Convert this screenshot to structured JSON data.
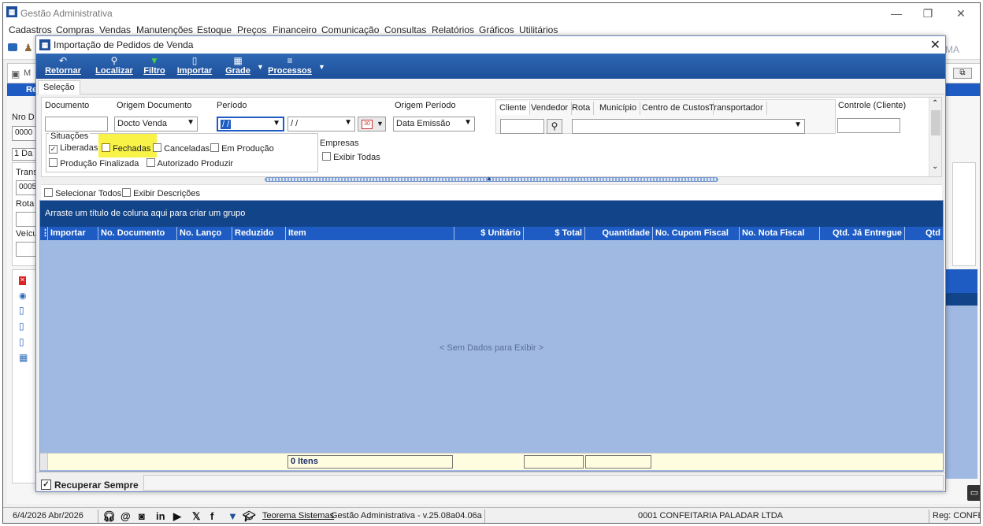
{
  "main_window": {
    "title": "Gestão Administrativa",
    "menu": [
      "Cadastros",
      "Compras",
      "Vendas",
      "Manutenções",
      "Estoque",
      "Preços",
      "Financeiro",
      "Comunicação",
      "Consultas",
      "Relatórios",
      "Gráficos",
      "Utilitários"
    ],
    "controls": {
      "minimize": "—",
      "maximize": "❐",
      "close": "✕"
    },
    "bg_fragments": {
      "nro": "Nro D",
      "nro_val": "0000",
      "tab": "1 Da",
      "trans": "Trans",
      "trans_val": "0005",
      "rota": "Rota",
      "veic": "Veícu",
      "ma": "MA",
      "re": "Re",
      "m": "M"
    }
  },
  "dialog": {
    "title": "Importação de Pedidos de Venda",
    "close": "✕",
    "toolbar": {
      "retornar": "Retornar",
      "localizar": "Localizar",
      "filtro": "Filtro",
      "importar": "Importar",
      "grade": "Grade",
      "processos": "Processos"
    },
    "tab": "Seleção",
    "filters": {
      "documento_label": "Documento",
      "documento_value": "",
      "origem_documento_label": "Origem Documento",
      "origem_documento_value": "Docto Venda",
      "periodo_label": "Período",
      "periodo_inicio": " / /",
      "periodo_fim": " / /",
      "origem_periodo_label": "Origem Período",
      "origem_periodo_value": "Data Emissão",
      "controle_label": "Controle (Cliente)",
      "controle_value": "",
      "situacoes_label": "Situações",
      "situacoes": [
        {
          "label": "Liberadas",
          "checked": true
        },
        {
          "label": "Fechadas",
          "checked": false
        },
        {
          "label": "Canceladas",
          "checked": false
        },
        {
          "label": "Em Produção",
          "checked": false
        },
        {
          "label": "Produção Finalizada",
          "checked": false
        },
        {
          "label": "Autorizado Produzir",
          "checked": false
        }
      ],
      "empresas_label": "Empresas",
      "exibir_todas": "Exibir Todas",
      "cliente_tabs": [
        "Cliente",
        "Vendedor",
        "Rota",
        "Município",
        "Centro de Custos",
        "Transportador"
      ]
    },
    "selecionar_todos": "Selecionar Todos",
    "exibir_descricoes": "Exibir Descrições",
    "grid": {
      "group_hint": "Arraste um título de coluna aqui para criar um grupo",
      "columns": [
        "Importar",
        "No. Documento",
        "No. Lanço",
        "Reduzido",
        "Item",
        "$ Unitário",
        "$ Total",
        "Quantidade",
        "No. Cupom Fiscal",
        "No. Nota Fiscal",
        "Qtd. Já Entregue",
        "Qtd"
      ],
      "empty_message": "< Sem Dados para Exibir >",
      "footer_count": "0 Itens"
    },
    "recuperar_sempre": "Recuperar Sempre"
  },
  "statusbar": {
    "date": "6/4/2026 Abr/2026",
    "teorema": "Teorema Sistemas",
    "version": "Gestão Administrativa - v.25.08a04.06a",
    "company": "0001 CONFEITARIA PALADAR LTDA",
    "reg": "Reg: CONFE"
  },
  "colors": {
    "toolbar": "#1d4f9a",
    "grid_header": "#1e5cc4",
    "group_panel": "#124489",
    "grid_body": "#a0b9e2",
    "highlight": "#f8f346"
  }
}
